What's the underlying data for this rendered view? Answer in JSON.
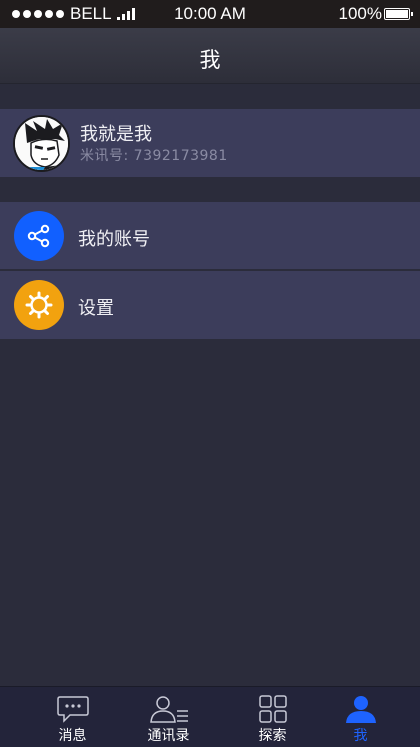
{
  "status_bar": {
    "carrier": "BELL",
    "time": "10:00 AM",
    "battery": "100%"
  },
  "header": {
    "title": "我"
  },
  "profile": {
    "name": "我就是我",
    "id_text": "米讯号: 7392173981"
  },
  "menu": {
    "items": [
      {
        "label": "我的账号",
        "icon": "share-icon",
        "color": "#1160ff"
      },
      {
        "label": "设置",
        "icon": "gear-icon",
        "color": "#f2a20f"
      }
    ]
  },
  "tabs": [
    {
      "label": "消息",
      "icon": "chat-bubble-icon",
      "active": false
    },
    {
      "label": "通讯录",
      "icon": "contacts-icon",
      "active": false
    },
    {
      "label": "探索",
      "icon": "grid-icon",
      "active": false
    },
    {
      "label": "我",
      "icon": "person-icon",
      "active": true
    }
  ],
  "colors": {
    "background": "#2b2c3b",
    "row": "#3c3d5b",
    "active_tab": "#1e63ff"
  }
}
